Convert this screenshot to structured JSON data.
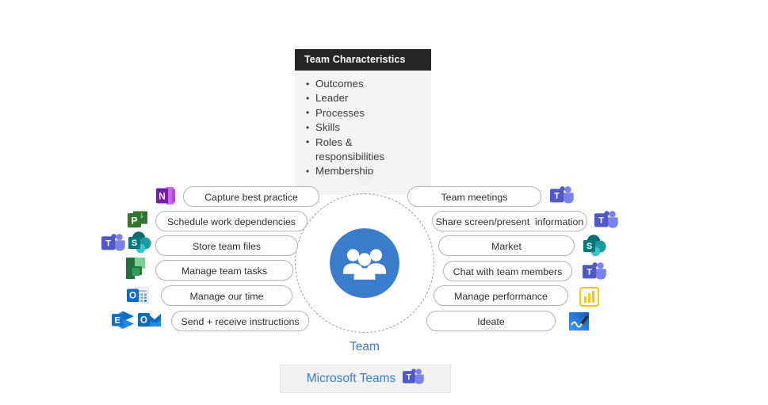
{
  "card": {
    "title": "Team Characteristics",
    "items": [
      "Outcomes",
      "Leader",
      "Processes",
      "Skills",
      "Roles & responsibilities",
      "Membership"
    ]
  },
  "center": {
    "label": "Team",
    "icon": "people-group-icon",
    "accent_color": "#3a7dcd"
  },
  "left_nodes": [
    {
      "label": "Capture best practice",
      "icons": [
        "onenote-icon"
      ]
    },
    {
      "label": "Schedule work dependencies",
      "icons": [
        "project-icon"
      ]
    },
    {
      "label": "Store team files",
      "icons": [
        "teams-icon",
        "sharepoint-icon"
      ]
    },
    {
      "label": "Manage team tasks",
      "icons": [
        "planner-icon"
      ]
    },
    {
      "label": "Manage our time",
      "icons": [
        "outlook-calendar-icon"
      ]
    },
    {
      "label": "Send + receive instructions",
      "icons": [
        "exchange-icon",
        "outlook-icon"
      ]
    }
  ],
  "right_nodes": [
    {
      "label": "Team meetings",
      "icons": [
        "teams-icon"
      ]
    },
    {
      "label": "Share screen/present  information",
      "icons": [
        "teams-icon"
      ]
    },
    {
      "label": "Market",
      "icons": [
        "sharepoint-icon"
      ]
    },
    {
      "label": "Chat with team members",
      "icons": [
        "teams-icon"
      ]
    },
    {
      "label": "Manage performance",
      "icons": [
        "powerbi-icon"
      ]
    },
    {
      "label": "Ideate",
      "icons": [
        "whiteboard-icon"
      ]
    }
  ],
  "footer": {
    "label": "Microsoft Teams",
    "icon": "teams-icon"
  },
  "colors": {
    "header_bg": "#262626",
    "card_bg": "#f4f4f4",
    "accent_blue": "#3a7dcd",
    "footer_bg": "#f2f2f2",
    "pill_border": "#b3b3b3"
  }
}
